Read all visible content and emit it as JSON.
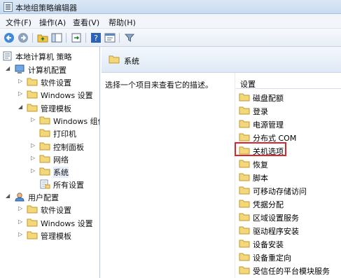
{
  "window": {
    "title": "本地组策略编辑器"
  },
  "menu": [
    "文件(F)",
    "操作(A)",
    "查看(V)",
    "帮助(H)"
  ],
  "toolbar": [
    "back-icon",
    "forward-icon",
    "up-folder-icon",
    "show-tree-icon",
    "export-icon",
    "help-icon",
    "properties-icon",
    "filter-icon"
  ],
  "tree": {
    "root": "本地计算机 策略",
    "computer_config": "计算机配置",
    "software_settings": "软件设置",
    "windows_settings": "Windows 设置",
    "admin_templates": "管理模板",
    "windows_components": "Windows 组件",
    "printers": "打印机",
    "control_panel": "控制面板",
    "network": "网络",
    "system": "系统",
    "all_settings": "所有设置",
    "user_config": "用户配置",
    "user_software_settings": "软件设置",
    "user_windows_settings": "Windows 设置",
    "user_admin_templates": "管理模板"
  },
  "main": {
    "header_title": "系统",
    "description": "选择一个项目来查看它的描述。",
    "column_header": "设置",
    "highlighted": "关机选项",
    "settings": [
      "磁盘配额",
      "登录",
      "电源管理",
      "分布式 COM",
      "关机选项",
      "恢复",
      "脚本",
      "可移动存储访问",
      "凭据分配",
      "区域设置服务",
      "驱动程序安装",
      "设备安装",
      "设备重定向",
      "受信任的平台模块服务"
    ]
  }
}
